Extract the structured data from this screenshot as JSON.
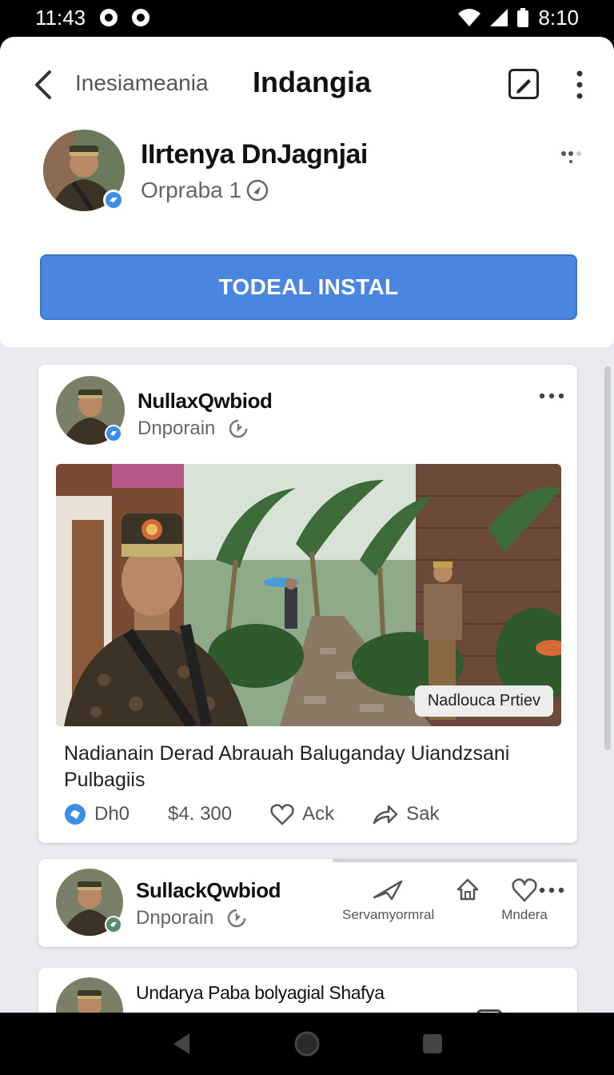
{
  "status_bar": {
    "time": "11:43",
    "battery_time": "8:10"
  },
  "app_bar": {
    "subtitle": "Inesiameania",
    "title": "Indangia"
  },
  "profile": {
    "name": "IIrtenya DnJagnjai",
    "sub": "Orpraba 1"
  },
  "primary_button": "TODEAL INSTAL",
  "post1": {
    "author": "NullaxQwbiod",
    "sub": "Dnporain",
    "image_chip": "Nadlouca Prtiev",
    "text": "Nadianain Derad Abrauah Baluganday Uiandzsani Pulbagiis",
    "actions": [
      {
        "icon": "like-badge-icon",
        "label": "Dh0"
      },
      {
        "icon": "dollar-icon",
        "label": "$4. 300"
      },
      {
        "icon": "heart-icon",
        "label": "Ack"
      },
      {
        "icon": "share-icon",
        "label": "Sak"
      }
    ]
  },
  "post2": {
    "author": "SullackQwbiod",
    "sub": "Dnporain",
    "mini_actions": [
      {
        "icon": "plane-icon",
        "label": "Servamyormral"
      },
      {
        "icon": "home-icon",
        "label": ""
      },
      {
        "icon": "heart-icon",
        "label": "Mndera"
      }
    ]
  },
  "post3": {
    "author": "Undarya Paba bolyagial Shafya"
  },
  "colors": {
    "primary": "#4a86e0",
    "background": "#e9ebee",
    "verified": "#3b8ee8"
  }
}
